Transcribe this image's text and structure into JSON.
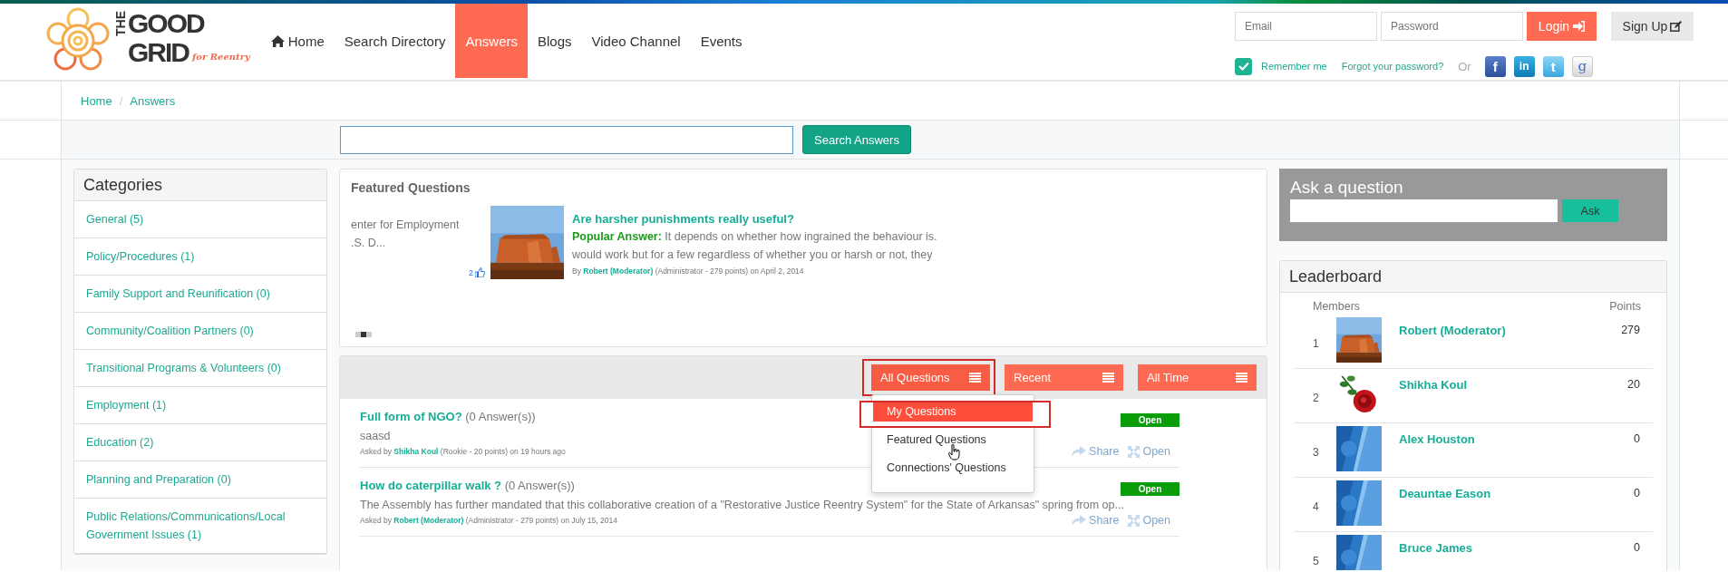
{
  "top_nav": {
    "logo": {
      "the": "THE",
      "word1": "GOOD",
      "word2": "GRID",
      "tagline": "for Reentry"
    },
    "items": [
      {
        "label": "Home",
        "kind": "home",
        "selected": false
      },
      {
        "label": "Search Directory",
        "kind": "text",
        "selected": false
      },
      {
        "label": "Answers",
        "kind": "text",
        "selected": true
      },
      {
        "label": "Blogs",
        "kind": "text",
        "selected": false
      },
      {
        "label": "Video Channel",
        "kind": "text",
        "selected": false
      },
      {
        "label": "Events",
        "kind": "text",
        "selected": false
      }
    ]
  },
  "login": {
    "email_placeholder": "Email",
    "password_placeholder": "Password",
    "login_button": "Login",
    "signup_button": "Sign Up",
    "remember_me": {
      "label": "Remember me",
      "checked": true
    },
    "forgot_link": "Forgot your password?",
    "or_text": "Or",
    "social": [
      {
        "kind": "facebook",
        "glyph": "f"
      },
      {
        "kind": "linkedin",
        "glyph": "in"
      },
      {
        "kind": "twitter",
        "glyph": "t"
      },
      {
        "kind": "google",
        "glyph": "g"
      }
    ]
  },
  "breadcrumb": {
    "separator": "/",
    "items": [
      {
        "label": "Home"
      },
      {
        "label": "Answers"
      }
    ]
  },
  "search": {
    "button": "Search Answers"
  },
  "categories": {
    "title": "Categories",
    "items": [
      {
        "label": "General (5)"
      },
      {
        "label": "Policy/Procedures (1)"
      },
      {
        "label": "Family Support and Reunification (0)"
      },
      {
        "label": "Community/Coalition Partners (0)"
      },
      {
        "label": "Transitional Programs & Volunteers (0)"
      },
      {
        "label": "Employment (1)"
      },
      {
        "label": "Education (2)"
      },
      {
        "label": "Planning and Preparation (0)"
      },
      {
        "label": "Public Relations/Communications/Local Government Issues (1)"
      }
    ]
  },
  "featured": {
    "title": "Featured Questions",
    "previous_slide": {
      "lines": [
        "enter for Employment",
        ".S. D..."
      ],
      "likes": "2"
    },
    "slide": {
      "image": {
        "kind": "picture"
      },
      "title": "Are harsher punishments really useful?",
      "answer_lines": [
        "**Popular Answer:** It depends on whether how ingrained the behaviour is.",
        "would work but for a few regardless of whether you or harsh or not, they"
      ],
      "byline": {
        "prefix": "By",
        "author": "Robert (Moderator)",
        "details": "(Administrator - 279 points)  on April 2, 2014"
      }
    },
    "pager": [
      {
        "selected": false
      },
      {
        "selected": true
      },
      {
        "selected": false
      }
    ]
  },
  "questions": {
    "filters": [
      {
        "label": "All Questions",
        "highlighted": true,
        "expanded": true
      },
      {
        "label": "Recent",
        "highlighted": false,
        "expanded": false
      },
      {
        "label": "All Time",
        "highlighted": false,
        "expanded": false
      }
    ],
    "dropdown": [
      {
        "label": "My Questions",
        "selected": true,
        "highlighted": true
      },
      {
        "label": "Featured Questions",
        "selected": false,
        "highlighted": false
      },
      {
        "label": "Connections' Questions",
        "selected": false,
        "highlighted": false
      }
    ],
    "items": [
      {
        "title": "Full form of NGO?",
        "answers": "(0 Answer(s))",
        "body": "saasd",
        "asked_by": "Asked by",
        "author": "Shikha Koul",
        "details": "(Rookie - 20 points) on 19 hours ago",
        "status": "Open",
        "share": "Share",
        "open": "Open"
      },
      {
        "title": "How do caterpillar walk ?",
        "answers": "(0 Answer(s))",
        "body": "The Assembly has further mandated that this collaborative creation of a \"Restorative Justice Reentry System\" for the State of Arkansas\" spring from op...",
        "asked_by": "Asked by",
        "author": "Robert (Moderator)",
        "details": "(Administrator - 279 points) on July 15, 2014",
        "status": "Open",
        "share": "Share",
        "open": "Open"
      }
    ]
  },
  "ask": {
    "title": "Ask a question",
    "button": "Ask"
  },
  "leaderboard": {
    "title": "Leaderboard",
    "columns": [
      "Members",
      "Points"
    ],
    "rows": [
      {
        "rank": "1",
        "avatar": {
          "kind": "picture"
        },
        "name": "Robert (Moderator)",
        "points": "279"
      },
      {
        "rank": "2",
        "avatar": {
          "kind": "picture"
        },
        "name": "Shikha Koul",
        "points": "20"
      },
      {
        "rank": "3",
        "avatar": {
          "kind": "picture"
        },
        "name": "Alex Houston",
        "points": "0"
      },
      {
        "rank": "4",
        "avatar": {
          "kind": "picture"
        },
        "name": "Deauntae Eason",
        "points": "0"
      },
      {
        "rank": "5",
        "avatar": {
          "kind": "picture"
        },
        "name": "Bruce James",
        "points": "0"
      }
    ]
  }
}
